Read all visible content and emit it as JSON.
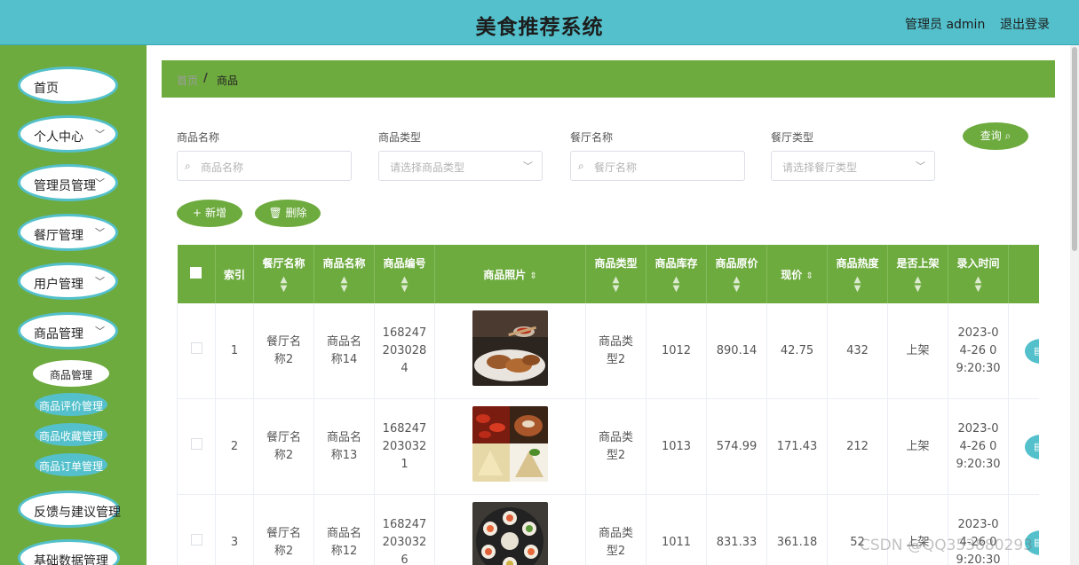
{
  "header": {
    "title": "美食推荐系统",
    "user": "管理员 admin",
    "logout": "退出登录"
  },
  "sidebar": {
    "items": [
      {
        "label": "首页",
        "has_children": false
      },
      {
        "label": "个人中心",
        "has_children": true
      },
      {
        "label": "管理员管理",
        "has_children": true
      },
      {
        "label": "餐厅管理",
        "has_children": true
      },
      {
        "label": "用户管理",
        "has_children": true
      },
      {
        "label": "商品管理",
        "has_children": true
      },
      {
        "label": "反馈与建议管理",
        "has_children": true
      },
      {
        "label": "基础数据管理",
        "has_children": true
      }
    ],
    "sub_items": [
      {
        "label": "商品管理",
        "active": true
      },
      {
        "label": "商品评价管理",
        "active": false
      },
      {
        "label": "商品收藏管理",
        "active": false
      },
      {
        "label": "商品订单管理",
        "active": false
      }
    ]
  },
  "breadcrumb": {
    "home": "首页",
    "separator": "/",
    "current": "商品"
  },
  "filters": {
    "goods_name": {
      "label": "商品名称",
      "placeholder": "商品名称"
    },
    "goods_type": {
      "label": "商品类型",
      "placeholder": "请选择商品类型"
    },
    "restaurant_name": {
      "label": "餐厅名称",
      "placeholder": "餐厅名称"
    },
    "restaurant_type": {
      "label": "餐厅类型",
      "placeholder": "请选择餐厅类型"
    },
    "query_button": "查询"
  },
  "actions": {
    "add": "新增",
    "delete": "删除"
  },
  "table": {
    "columns": [
      "索引",
      "餐厅名称",
      "商品名称",
      "商品编号",
      "商品照片",
      "商品类型",
      "商品库存",
      "商品原价",
      "现价",
      "商品热度",
      "是否上架",
      "录入时间"
    ],
    "rows": [
      {
        "index": "1",
        "restaurant": "餐厅名称2",
        "name": "商品名称14",
        "code": "1682472030284",
        "type": "商品类型2",
        "stock": "1012",
        "original_price": "890.14",
        "price": "42.75",
        "heat": "432",
        "on_sale": "上架",
        "time": "2023-04-26 09:20:30"
      },
      {
        "index": "2",
        "restaurant": "餐厅名称2",
        "name": "商品名称13",
        "code": "1682472030321",
        "type": "商品类型2",
        "stock": "1013",
        "original_price": "574.99",
        "price": "171.43",
        "heat": "212",
        "on_sale": "上架",
        "time": "2023-04-26 09:20:30"
      },
      {
        "index": "3",
        "restaurant": "餐厅名称2",
        "name": "商品名称12",
        "code": "1682472030326",
        "type": "商品类型2",
        "stock": "1011",
        "original_price": "831.33",
        "price": "361.18",
        "heat": "52",
        "on_sale": "上架",
        "time": "2023-04-26 09:20:30"
      }
    ]
  },
  "watermark": "CSDN @QQ353880293",
  "colors": {
    "header": "#53c0cb",
    "sidebar": "#6eab3f",
    "accent_green": "#6eab3f",
    "accent_teal": "#53c0cb"
  }
}
